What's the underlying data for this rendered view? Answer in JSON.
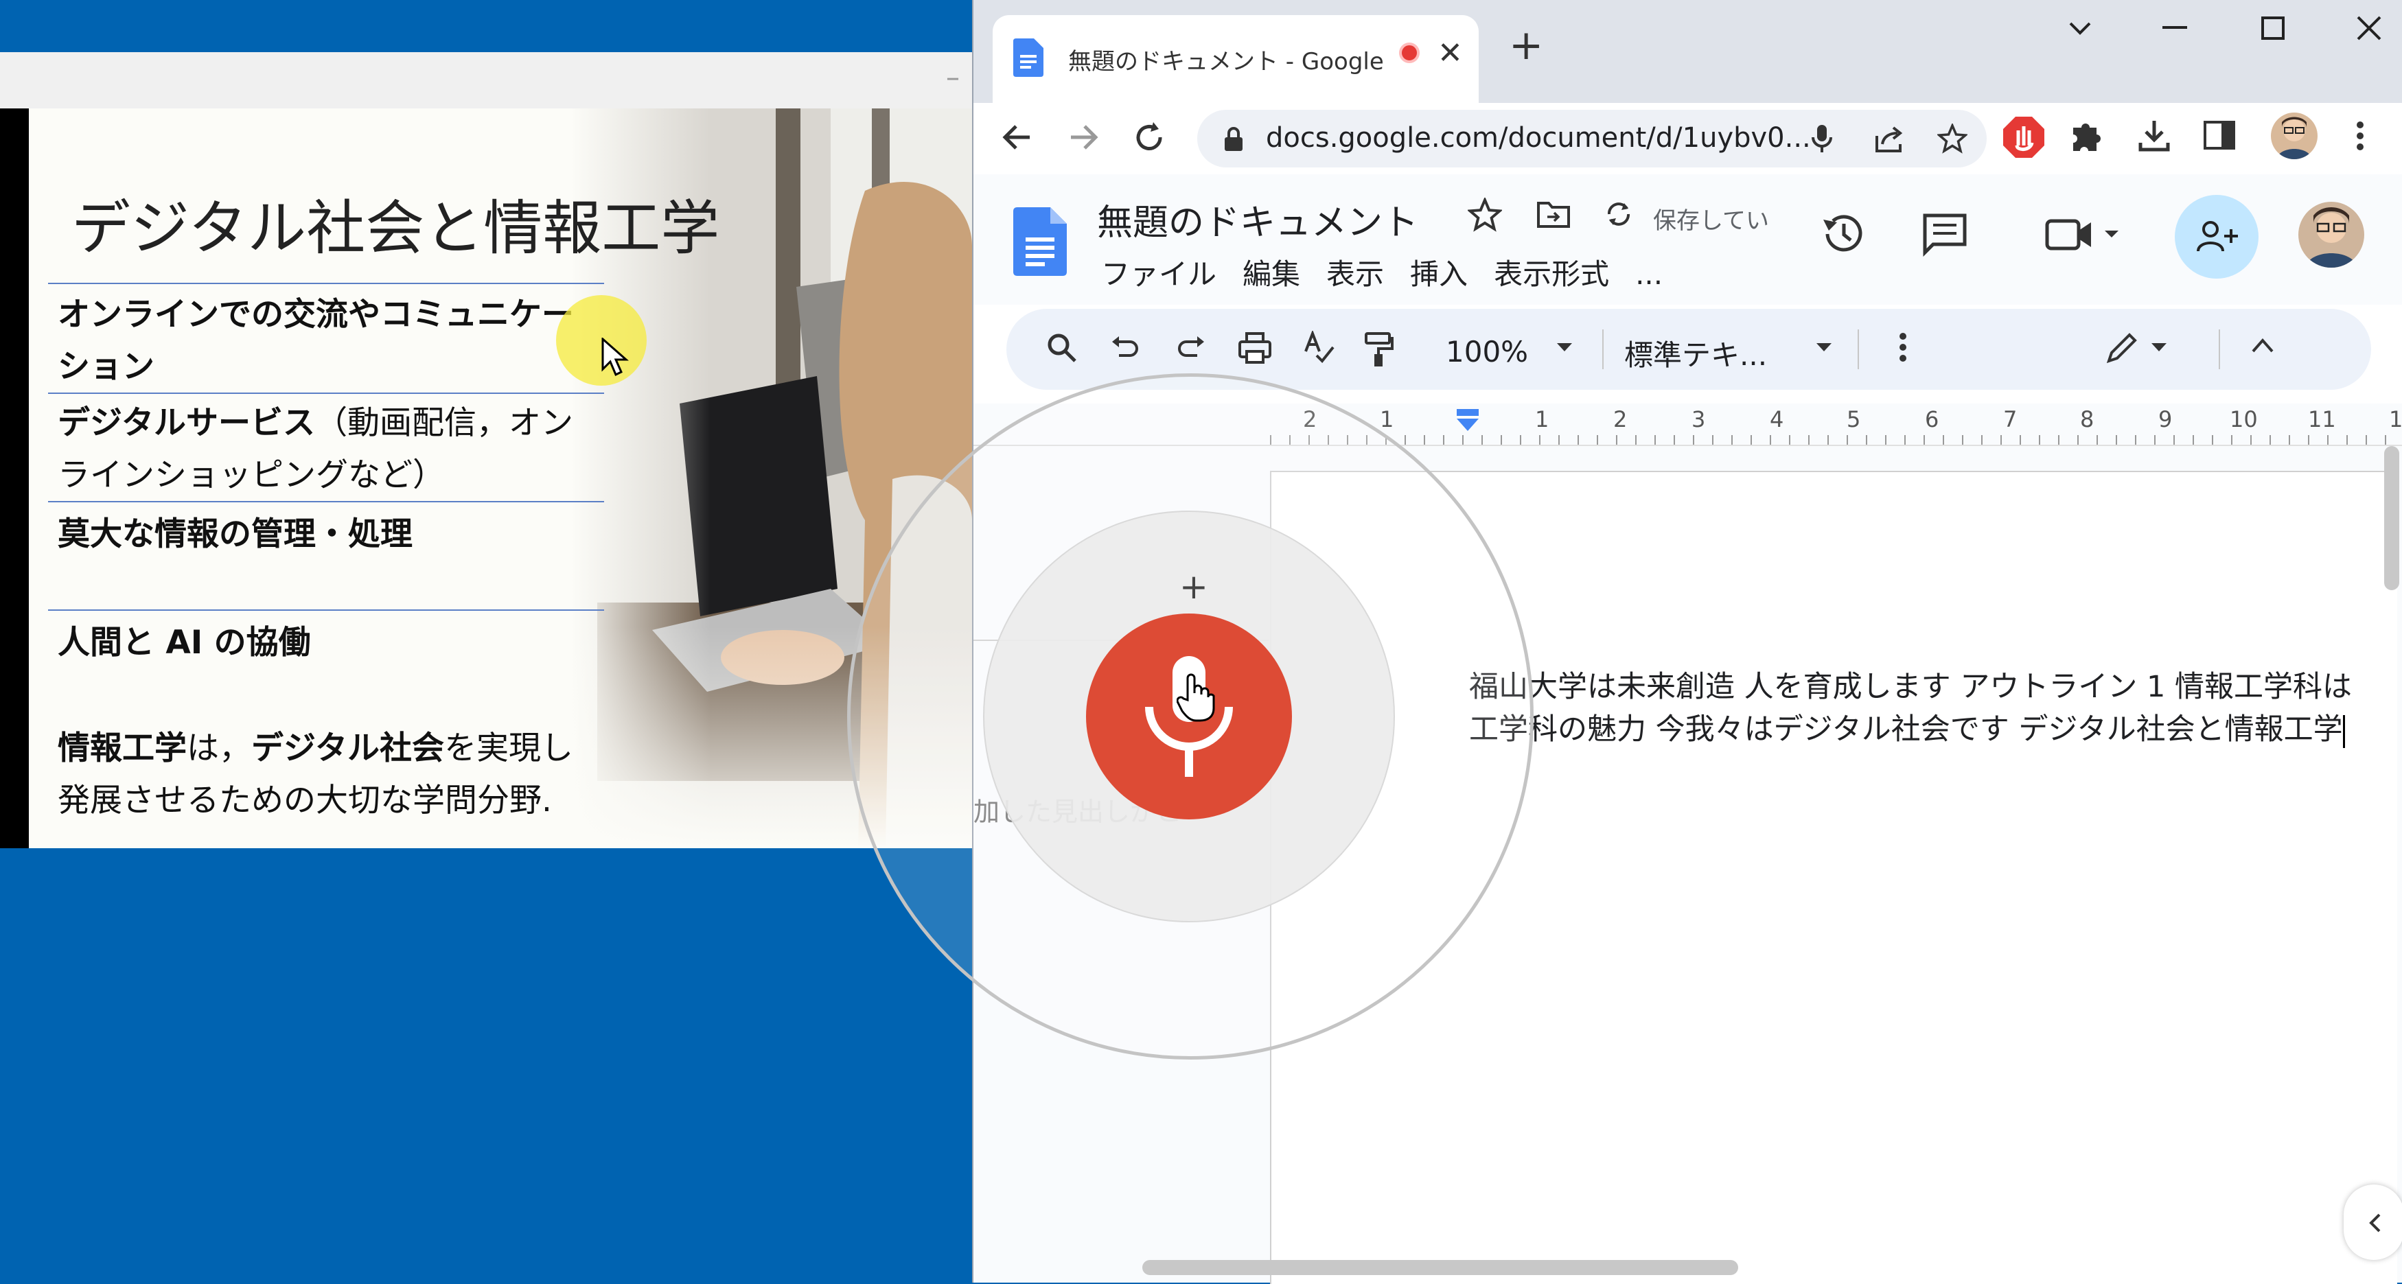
{
  "slide": {
    "title": "デジタル社会と情報工学",
    "items": [
      {
        "bold": "オンラインでの交流やコミュニケー",
        "rest": ""
      },
      {
        "bold": "ション",
        "rest": ""
      },
      {
        "bold": "デジタルサービス",
        "rest": "（動画配信，オン"
      },
      {
        "bold": "",
        "rest": "ラインショッピングなど）"
      },
      {
        "bold": "莫大な情報の管理・処理",
        "rest": ""
      },
      {
        "bold": "人間と AI の協働",
        "rest": ""
      }
    ],
    "conclusion_line1": [
      "情報工学",
      "は，",
      "デジタル社会",
      "を実現し"
    ],
    "conclusion_line2": "発展させるための大切な学問分野."
  },
  "browser": {
    "tab_title": "無題のドキュメント - Google ドキ",
    "url": "docs.google.com/document/d/1uybv0...",
    "window_controls": [
      "chevron-down-icon",
      "minimize-icon",
      "maximize-icon",
      "close-icon"
    ]
  },
  "docs": {
    "title": "無題のドキュメント",
    "save_status": "保存してい",
    "menu": [
      "ファイル",
      "編集",
      "表示",
      "挿入",
      "表示形式",
      "..."
    ],
    "zoom": "100%",
    "style": "標準テキ...",
    "ruler_numbers": [
      "2",
      "1",
      "1",
      "2",
      "3",
      "4",
      "5",
      "6",
      "7",
      "8",
      "9",
      "10",
      "11",
      "1"
    ],
    "body_line1": "福山大学は未来創造 人を育成します アウトライン 1 情報工学科は",
    "body_line2": "工学科の魅力 今我々はデジタル社会です デジタル社会と情報工学",
    "outline_fragment": "加した見出しがこ",
    "voice_plus": "+"
  },
  "colors": {
    "desktop": "#0063b1",
    "mic": "#dd4b35",
    "docs_blue": "#4285f4",
    "share_bg": "#c2e7ff"
  }
}
